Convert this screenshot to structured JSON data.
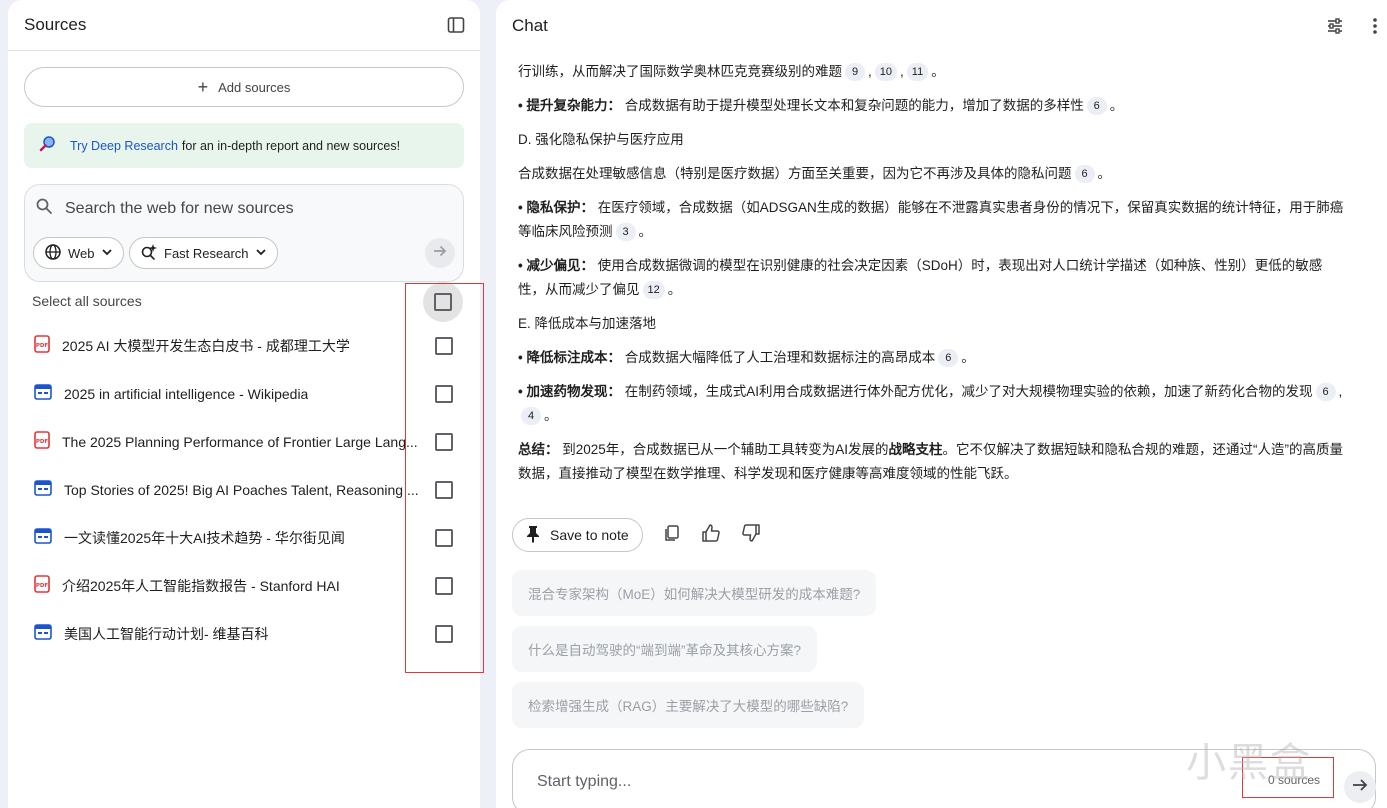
{
  "sources_panel": {
    "title": "Sources",
    "add_sources_label": "Add sources",
    "deep_research": {
      "link_text": "Try Deep Research",
      "rest_text": "for an in-depth report and new sources!"
    },
    "search": {
      "placeholder": "Search the web for new sources",
      "web_chip": "Web",
      "fast_chip": "Fast Research"
    },
    "select_all_label": "Select all sources",
    "items": [
      {
        "title": "2025 AI 大模型开发生态白皮书 - 成都理工大学",
        "type": "pdf"
      },
      {
        "title": "2025 in artificial intelligence - Wikipedia",
        "type": "web"
      },
      {
        "title": "The 2025 Planning Performance of Frontier Large Lang...",
        "type": "pdf"
      },
      {
        "title": "Top Stories of 2025! Big AI Poaches Talent, Reasoning ...",
        "type": "web"
      },
      {
        "title": "一文读懂2025年十大AI技术趋势 - 华尔街见闻",
        "type": "web"
      },
      {
        "title": "介绍2025年人工智能指数报告 - Stanford HAI",
        "type": "pdf"
      },
      {
        "title": "美国人工智能行动计划- 维基百科",
        "type": "web"
      }
    ]
  },
  "chat_panel": {
    "title": "Chat",
    "p1": {
      "text": "行训练，从而解决了国际数学奥林匹克竞赛级别的难题",
      "c1": "9",
      "c2": "10",
      "c3": "11",
      "end": "。"
    },
    "p2": {
      "bold": "• 提升复杂能力：",
      "text": " 合成数据有助于提升模型处理长文本和复杂问题的能力，增加了数据的多样性",
      "c1": "6",
      "end": "。"
    },
    "h_d": "D. 强化隐私保护与医疗应用",
    "p3": {
      "text": "合成数据在处理敏感信息（特别是医疗数据）方面至关重要，因为它不再涉及具体的隐私问题",
      "c1": "6",
      "end": "。"
    },
    "p4": {
      "bold": "• 隐私保护：",
      "text": " 在医疗领域，合成数据（如ADSGAN生成的数据）能够在不泄露真实患者身份的情况下，保留真实数据的统计特征，用于肺癌等临床风险预测",
      "c1": "3",
      "end": "。"
    },
    "p5": {
      "bold": "• 减少偏见：",
      "text": " 使用合成数据微调的模型在识别健康的社会决定因素（SDoH）时，表现出对人口统计学描述（如种族、性别）更低的敏感性，从而减少了偏见",
      "c1": "12",
      "end": "。"
    },
    "h_e": "E. 降低成本与加速落地",
    "p6": {
      "bold": "• 降低标注成本：",
      "text": " 合成数据大幅降低了人工治理和数据标注的高昂成本",
      "c1": "6",
      "end": "。"
    },
    "p7": {
      "bold": "• 加速药物发现：",
      "text": " 在制药领域，生成式AI利用合成数据进行体外配方优化，减少了对大规模物理实验的依赖，加速了新药化合物的发现",
      "c1": "6",
      "c2": "4",
      "end": "。"
    },
    "p8": {
      "bold": "总结：",
      "text1": " 到2025年，合成数据已从一个辅助工具转变为AI发展的",
      "bold2": "战略支柱",
      "text2": "。它不仅解决了数据短缺和隐私合规的难题，还通过“人造”的高质量数据，直接推动了模型在数学推理、科学发现和医疗健康等高难度领域的性能飞跃。"
    },
    "save_to_note": "Save to note",
    "suggestions": [
      "混合专家架构（MoE）如何解决大模型研发的成本难题?",
      "什么是自动驾驶的“端到端”革命及其核心方案?",
      "检索增强生成（RAG）主要解决了大模型的哪些缺陷?"
    ],
    "composer": {
      "placeholder": "Start typing...",
      "source_count": "0 sources"
    }
  },
  "watermark": "小黑盒",
  "colors": {
    "pdf_icon": "#e0373a",
    "web_icon": "#1a56c8",
    "deep_link": "#1a56c8",
    "annotation_frame": "#e0373a"
  }
}
